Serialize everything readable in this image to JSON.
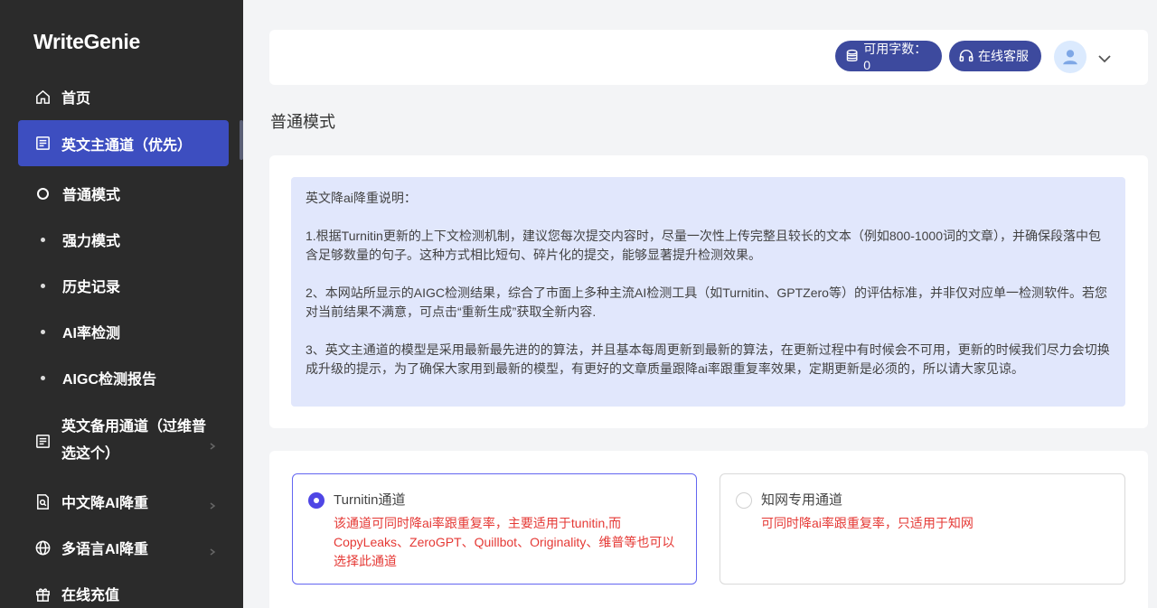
{
  "app": {
    "name": "WriteGenie"
  },
  "sidebar": {
    "home": "首页",
    "en_main": "英文主通道（优先）",
    "sub_items": [
      "普通模式",
      "强力模式",
      "历史记录",
      "AI率检测",
      "AIGC检测报告"
    ],
    "en_backup": "英文备用通道（过维普选这个）",
    "zh_reduce": "中文降AI降重",
    "multi_lang": "多语言AI降重",
    "recharge": "在线充值"
  },
  "header": {
    "words_label": "可用字数：0",
    "service_label": "在线客服"
  },
  "page": {
    "title": "普通模式"
  },
  "notice": {
    "heading": "英文降ai降重说明：",
    "p1": "1.根据Turnitin更新的上下文检测机制，建议您每次提交内容时，尽量一次性上传完整且较长的文本（例如800-1000词的文章），并确保段落中包含足够数量的句子。这种方式相比短句、碎片化的提交，能够显著提升检测效果。",
    "p2": "2、本网站所显示的AIGC检测结果，综合了市面上多种主流AI检测工具（如Turnitin、GPTZero等）的评估标准，并非仅对应单一检测软件。若您对当前结果不满意，可点击“重新生成”获取全新内容.",
    "p3": "3、英文主通道的模型是采用最新最先进的的算法，并且基本每周更新到最新的算法，在更新过程中有时候会不可用，更新的时候我们尽力会切换成升级的提示，为了确保大家用到最新的模型，有更好的文章质量跟降ai率跟重复率效果，定期更新是必须的，所以请大家见谅。"
  },
  "channels": [
    {
      "title": "Turnitin通道",
      "desc": "该通道可同时降ai率跟重复率，主要适用于tunitin,而CopyLeaks、ZeroGPT、Quillbot、Originality、维普等也可以选择此通道",
      "selected": true
    },
    {
      "title": "知网专用通道",
      "desc": "可同时降ai率跟重复率，只适用于知网",
      "selected": false
    }
  ],
  "colors": {
    "accent": "#3d4ec0",
    "pill": "#3d4a9e",
    "notice_bg": "#e1e7fc",
    "desc_red": "#e53935"
  }
}
